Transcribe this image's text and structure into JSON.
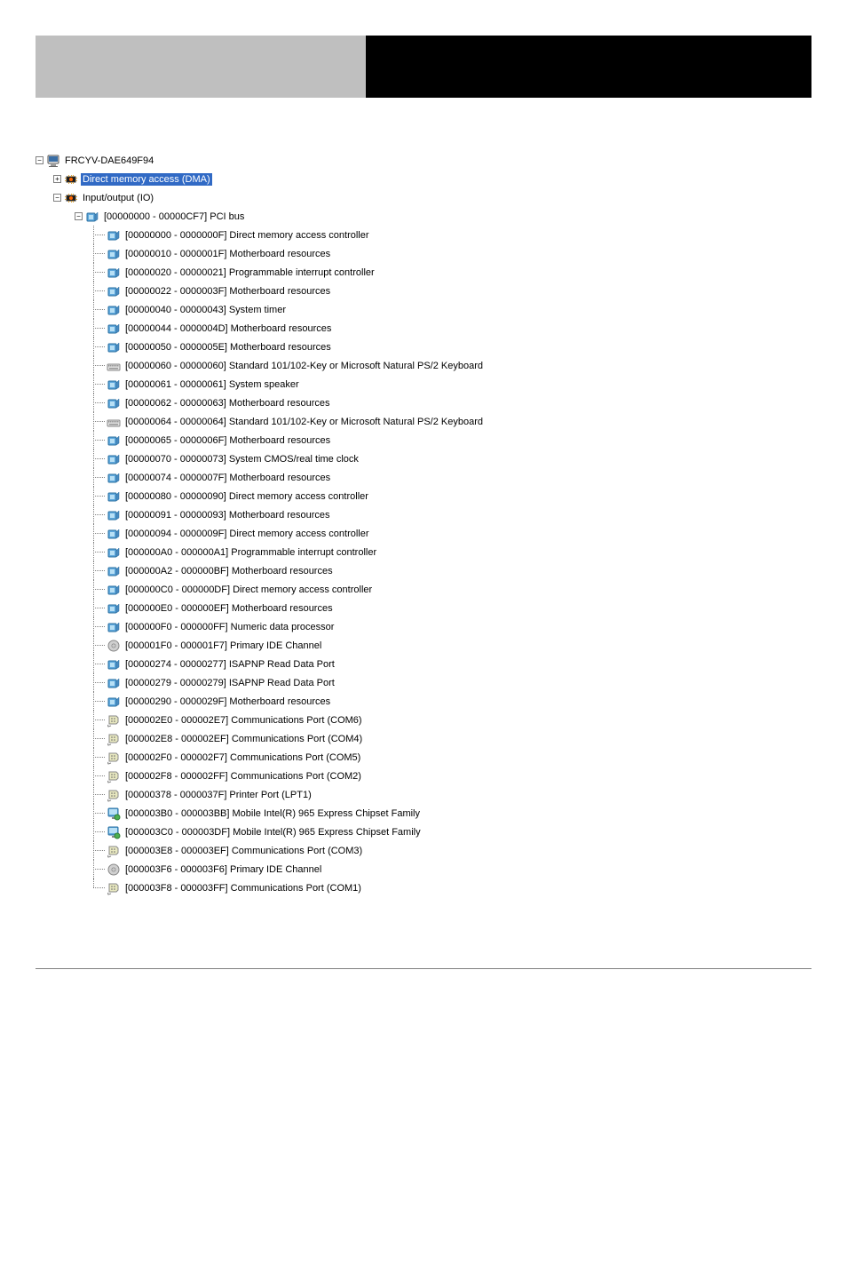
{
  "root": {
    "label": "FRCYV-DAE649F94",
    "children": [
      {
        "label": "Direct memory access (DMA)",
        "selected": true,
        "expanded": false,
        "icon": "chip"
      },
      {
        "label": "Input/output (IO)",
        "selected": false,
        "expanded": true,
        "icon": "chip",
        "children": [
          {
            "label": "[00000000 - 00000CF7]  PCI bus",
            "icon": "device",
            "expanded": true,
            "children": [
              {
                "label": "[00000000 - 0000000F]  Direct memory access controller",
                "icon": "device"
              },
              {
                "label": "[00000010 - 0000001F]  Motherboard resources",
                "icon": "device"
              },
              {
                "label": "[00000020 - 00000021]  Programmable interrupt controller",
                "icon": "device"
              },
              {
                "label": "[00000022 - 0000003F]  Motherboard resources",
                "icon": "device"
              },
              {
                "label": "[00000040 - 00000043]  System timer",
                "icon": "device"
              },
              {
                "label": "[00000044 - 0000004D]  Motherboard resources",
                "icon": "device"
              },
              {
                "label": "[00000050 - 0000005E]  Motherboard resources",
                "icon": "device"
              },
              {
                "label": "[00000060 - 00000060]  Standard 101/102-Key or Microsoft Natural PS/2 Keyboard",
                "icon": "keyboard"
              },
              {
                "label": "[00000061 - 00000061]  System speaker",
                "icon": "device"
              },
              {
                "label": "[00000062 - 00000063]  Motherboard resources",
                "icon": "device"
              },
              {
                "label": "[00000064 - 00000064]  Standard 101/102-Key or Microsoft Natural PS/2 Keyboard",
                "icon": "keyboard"
              },
              {
                "label": "[00000065 - 0000006F]  Motherboard resources",
                "icon": "device"
              },
              {
                "label": "[00000070 - 00000073]  System CMOS/real time clock",
                "icon": "device"
              },
              {
                "label": "[00000074 - 0000007F]  Motherboard resources",
                "icon": "device"
              },
              {
                "label": "[00000080 - 00000090]  Direct memory access controller",
                "icon": "device"
              },
              {
                "label": "[00000091 - 00000093]  Motherboard resources",
                "icon": "device"
              },
              {
                "label": "[00000094 - 0000009F]  Direct memory access controller",
                "icon": "device"
              },
              {
                "label": "[000000A0 - 000000A1]  Programmable interrupt controller",
                "icon": "device"
              },
              {
                "label": "[000000A2 - 000000BF]  Motherboard resources",
                "icon": "device"
              },
              {
                "label": "[000000C0 - 000000DF]  Direct memory access controller",
                "icon": "device"
              },
              {
                "label": "[000000E0 - 000000EF]  Motherboard resources",
                "icon": "device"
              },
              {
                "label": "[000000F0 - 000000FF]  Numeric data processor",
                "icon": "device"
              },
              {
                "label": "[000001F0 - 000001F7]  Primary IDE Channel",
                "icon": "disk"
              },
              {
                "label": "[00000274 - 00000277]  ISAPNP Read Data Port",
                "icon": "device"
              },
              {
                "label": "[00000279 - 00000279]  ISAPNP Read Data Port",
                "icon": "device"
              },
              {
                "label": "[00000290 - 0000029F]  Motherboard resources",
                "icon": "device"
              },
              {
                "label": "[000002E0 - 000002E7]  Communications Port (COM6)",
                "icon": "port"
              },
              {
                "label": "[000002E8 - 000002EF]  Communications Port (COM4)",
                "icon": "port"
              },
              {
                "label": "[000002F0 - 000002F7]  Communications Port (COM5)",
                "icon": "port"
              },
              {
                "label": "[000002F8 - 000002FF]  Communications Port (COM2)",
                "icon": "port"
              },
              {
                "label": "[00000378 - 0000037F]  Printer Port (LPT1)",
                "icon": "port"
              },
              {
                "label": "[000003B0 - 000003BB]  Mobile Intel(R) 965 Express Chipset Family",
                "icon": "display"
              },
              {
                "label": "[000003C0 - 000003DF]  Mobile Intel(R) 965 Express Chipset Family",
                "icon": "display"
              },
              {
                "label": "[000003E8 - 000003EF]  Communications Port (COM3)",
                "icon": "port"
              },
              {
                "label": "[000003F6 - 000003F6]  Primary IDE Channel",
                "icon": "disk"
              },
              {
                "label": "[000003F8 - 000003FF]  Communications Port (COM1)",
                "icon": "port"
              }
            ]
          }
        ]
      }
    ]
  }
}
